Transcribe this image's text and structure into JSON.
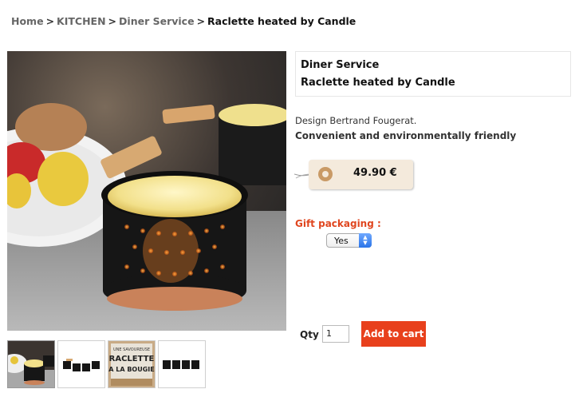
{
  "breadcrumb": {
    "home": "Home",
    "cat1": "KITCHEN",
    "cat2": "Diner Service",
    "current": "Raclette heated by Candle",
    "separator": ">"
  },
  "product": {
    "collection": "Diner Service",
    "name": "Raclette heated by Candle",
    "designer": "Design Bertrand Fougerat.",
    "tagline": "Convenient and environmentally friendly",
    "price": "49.90 €",
    "image_description": "raclette-pan-photo"
  },
  "gift": {
    "label": "Gift packaging :",
    "selected": "Yes"
  },
  "cart": {
    "qty_label": "Qty",
    "qty_value": "1",
    "button_label": "Add to cart"
  },
  "thumbnails": {
    "box_line1": "UNE SAVOUREUSE",
    "box_line2": "RACLETTE",
    "box_line3": "A LA BOUGIE"
  },
  "colors": {
    "accent": "#e8401c",
    "gift_label": "#e0461f",
    "price_tag": "#f4eadc"
  }
}
